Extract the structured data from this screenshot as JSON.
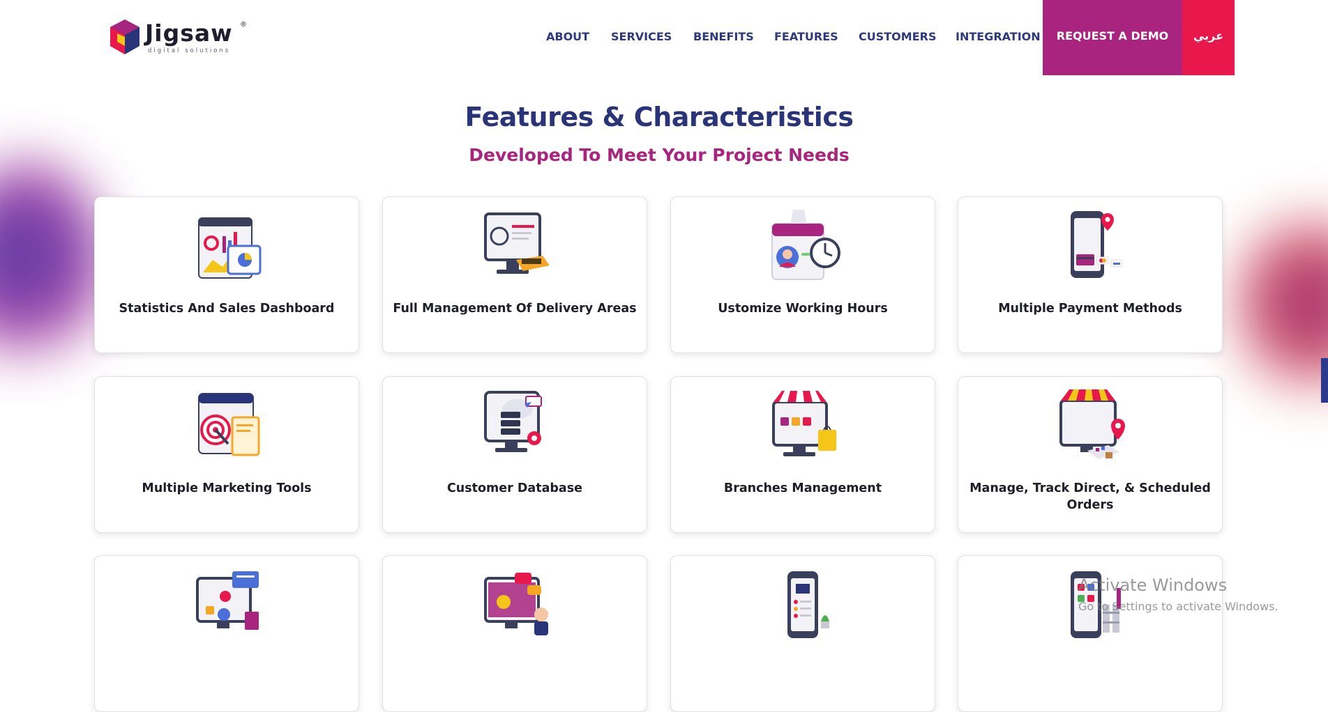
{
  "brand": {
    "name": "Jigsaw",
    "tagline": "digital solutions",
    "registered": "®",
    "colors": {
      "navy": "#2a3579",
      "magenta": "#a8247f",
      "red": "#e8184c"
    }
  },
  "nav": {
    "items": [
      "ABOUT",
      "SERVICES",
      "BENEFITS",
      "FEATURES",
      "CUSTOMERS",
      "INTEGRATION"
    ],
    "cta_label": "REQUEST A DEMO",
    "lang_label": "عربي"
  },
  "section": {
    "title": "Features & Characteristics",
    "subtitle": "Developed To Meet Your Project Needs"
  },
  "features": [
    {
      "label": "Statistics And Sales Dashboard",
      "icon": "dashboard-icon"
    },
    {
      "label": "Full Management Of Delivery Areas",
      "icon": "delivery-areas-icon"
    },
    {
      "label": "Ustomize Working Hours",
      "icon": "working-hours-icon"
    },
    {
      "label": "Multiple Payment Methods",
      "icon": "payment-methods-icon"
    },
    {
      "label": "Multiple Marketing Tools",
      "icon": "marketing-tools-icon"
    },
    {
      "label": "Customer Database",
      "icon": "customer-database-icon"
    },
    {
      "label": "Branches Management",
      "icon": "branches-icon"
    },
    {
      "label": "Manage, Track Direct, & Scheduled Orders",
      "icon": "orders-tracking-icon"
    },
    {
      "label": "",
      "icon": "ecommerce-icon"
    },
    {
      "label": "",
      "icon": "support-chat-icon"
    },
    {
      "label": "",
      "icon": "mobile-menu-icon"
    },
    {
      "label": "",
      "icon": "mobile-app-icon"
    }
  ],
  "os_watermark": {
    "title": "Activate Windows",
    "subtitle": "Go to Settings to activate Windows."
  }
}
